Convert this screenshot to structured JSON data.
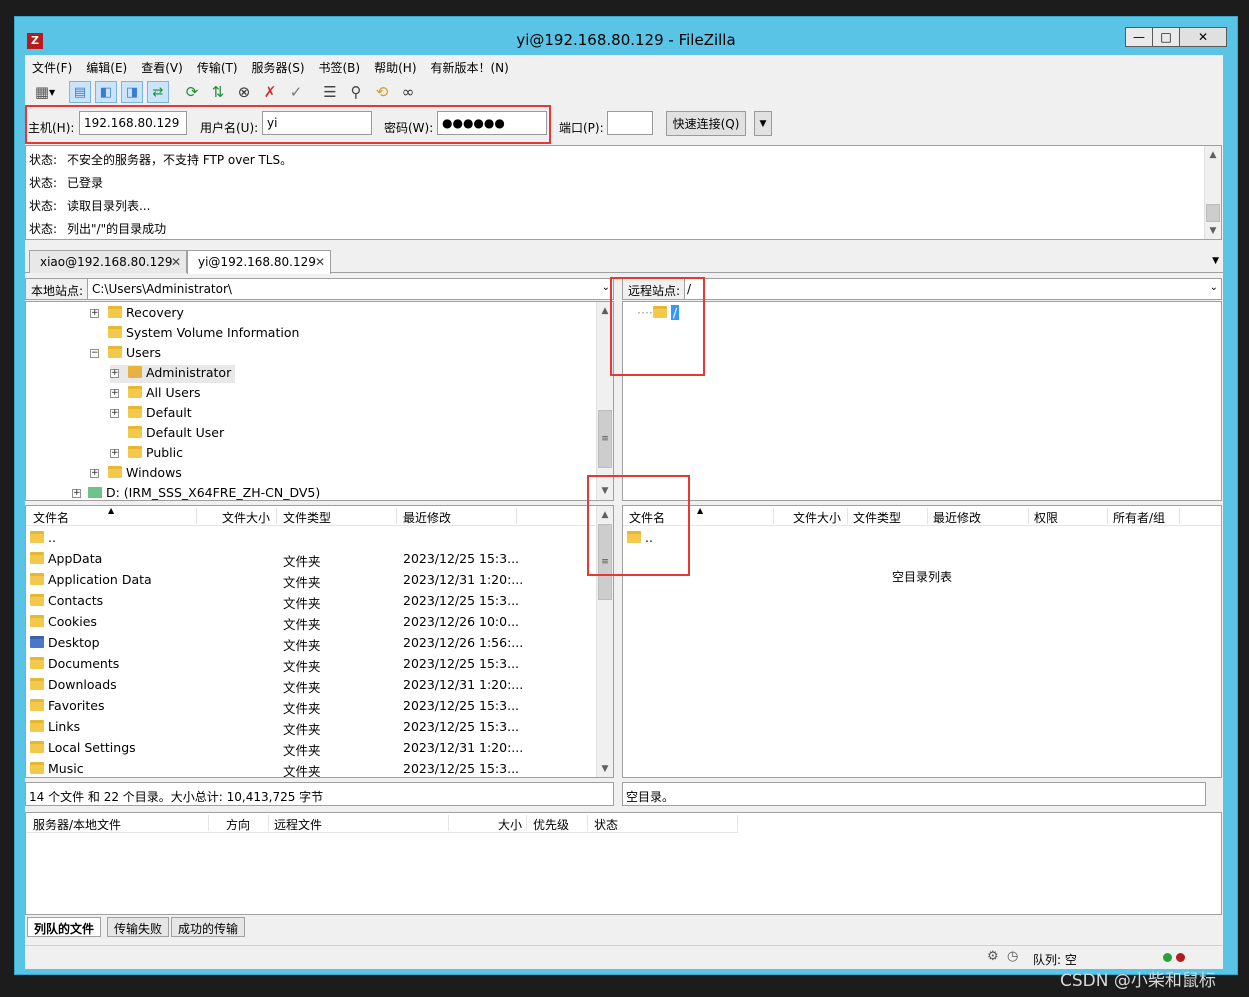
{
  "window": {
    "title": "yi@192.168.80.129 - FileZilla",
    "app_icon": "Z",
    "minimize": "—",
    "maximize": "□",
    "close": "✕"
  },
  "menu": [
    "文件(F)",
    "编辑(E)",
    "查看(V)",
    "传输(T)",
    "服务器(S)",
    "书签(B)",
    "帮助(H)",
    "有新版本！(N)"
  ],
  "quickconnect": {
    "host_label": "主机(H):",
    "host_value": "192.168.80.129",
    "user_label": "用户名(U):",
    "user_value": "yi",
    "pass_label": "密码(W):",
    "pass_value": "●●●●●●",
    "port_label": "端口(P):",
    "port_value": "",
    "connect_button": "快速连接(Q)",
    "dropdown_arrow": "▼"
  },
  "log": [
    {
      "key": "状态:",
      "text": "不安全的服务器，不支持 FTP over TLS。"
    },
    {
      "key": "状态:",
      "text": "已登录"
    },
    {
      "key": "状态:",
      "text": "读取目录列表..."
    },
    {
      "key": "状态:",
      "text": "列出\"/\"的目录成功"
    }
  ],
  "tabs": [
    {
      "label": "xiao@192.168.80.129",
      "close": "✕"
    },
    {
      "label": "yi@192.168.80.129",
      "close": "✕"
    }
  ],
  "local": {
    "site_label": "本地站点:",
    "site_path": "C:\\Users\\Administrator\\",
    "tree": [
      {
        "label": "Recovery",
        "exp": "+"
      },
      {
        "label": "System Volume Information",
        "exp": ""
      },
      {
        "label": "Users",
        "exp": "−"
      },
      {
        "label": "Administrator",
        "exp": "+"
      },
      {
        "label": "All Users",
        "exp": "+"
      },
      {
        "label": "Default",
        "exp": "+"
      },
      {
        "label": "Default User",
        "exp": ""
      },
      {
        "label": "Public",
        "exp": "+"
      },
      {
        "label": "Windows",
        "exp": "+"
      },
      {
        "label": "D: (IRM_SSS_X64FRE_ZH-CN_DV5)",
        "exp": "+"
      }
    ],
    "columns": [
      "文件名",
      "文件大小",
      "文件类型",
      "最近修改"
    ],
    "files": [
      {
        "name": "..",
        "type": "",
        "modified": ""
      },
      {
        "name": "AppData",
        "type": "文件夹",
        "modified": "2023/12/25 15:3..."
      },
      {
        "name": "Application Data",
        "type": "文件夹",
        "modified": "2023/12/31 1:20:..."
      },
      {
        "name": "Contacts",
        "type": "文件夹",
        "modified": "2023/12/25 15:3..."
      },
      {
        "name": "Cookies",
        "type": "文件夹",
        "modified": "2023/12/26 10:0..."
      },
      {
        "name": "Desktop",
        "type": "文件夹",
        "modified": "2023/12/26 1:56:..."
      },
      {
        "name": "Documents",
        "type": "文件夹",
        "modified": "2023/12/25 15:3..."
      },
      {
        "name": "Downloads",
        "type": "文件夹",
        "modified": "2023/12/31 1:20:..."
      },
      {
        "name": "Favorites",
        "type": "文件夹",
        "modified": "2023/12/25 15:3..."
      },
      {
        "name": "Links",
        "type": "文件夹",
        "modified": "2023/12/25 15:3..."
      },
      {
        "name": "Local Settings",
        "type": "文件夹",
        "modified": "2023/12/31 1:20:..."
      },
      {
        "name": "Music",
        "type": "文件夹",
        "modified": "2023/12/25 15:3..."
      }
    ],
    "status": "14 个文件 和 22 个目录。大小总计: 10,413,725 字节"
  },
  "remote": {
    "site_label": "远程站点:",
    "site_path": "/",
    "tree_root": "/",
    "columns": [
      "文件名",
      "文件大小",
      "文件类型",
      "最近修改",
      "权限",
      "所有者/组"
    ],
    "files": [
      {
        "name": ".."
      }
    ],
    "empty_text": "空目录列表",
    "status": "空目录。"
  },
  "queue": {
    "columns": [
      "服务器/本地文件",
      "方向",
      "远程文件",
      "大小",
      "优先级",
      "状态"
    ],
    "tabs": [
      "列队的文件",
      "传输失败",
      "成功的传输"
    ],
    "status": "队列: 空"
  },
  "watermark": "CSDN @小柴和鼠标",
  "colors": {
    "accent": "#5ac4e6",
    "highlight_red": "#e53935",
    "folder": "#f2c94c"
  }
}
